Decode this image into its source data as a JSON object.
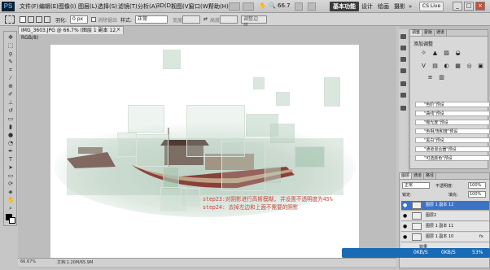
{
  "menubar": {
    "logo": "PS",
    "items": [
      "文件(F)",
      "编辑(E)",
      "图像(I)",
      "图层(L)",
      "选择(S)",
      "滤镜(T)",
      "分析(A)",
      "3D(D)",
      "视图(V)",
      "窗口(W)",
      "帮助(H)"
    ],
    "zoom": "66.7",
    "workspaces": [
      "基本功能",
      "设计",
      "绘画",
      "摄影",
      "»"
    ],
    "cs_live": "CS Live",
    "window_controls": [
      "_",
      "□",
      "×"
    ]
  },
  "options": {
    "feather_label": "羽化:",
    "feather_value": "0 px",
    "antialias": "消除锯齿",
    "style_label": "样式:",
    "style_value": "正常",
    "width_label": "宽度:",
    "height_label": "高度:",
    "refine": "调整边缘..."
  },
  "document": {
    "tab_title": "IMG_3603.JPG @ 66.7% (图层 1 副本 12, RGB/8)",
    "close": "×",
    "status_zoom": "66.67%",
    "status_doc": "文档:1.20M/65.9M",
    "step_lines": [
      "step23:对阴影进行高斯模糊, 并设置不透明度为45%",
      "step24: 去掉左边和上面不需要的阴影"
    ]
  },
  "adjust_panel": {
    "tabs": [
      "调整",
      "蒙版",
      "通道"
    ],
    "title": "添加调整",
    "icons": [
      "☼",
      "▲",
      "▨",
      "◒",
      "V",
      "▤",
      "◐",
      "▦",
      "◎",
      "▣",
      "≡",
      "▥"
    ],
    "presets": [
      "\"色阶\"预设",
      "\"曲线\"预设",
      "\"曝光度\"预设",
      "\"色相/饱和度\"预设",
      "\"黑白\"预设",
      "\"通道混合器\"预设",
      "\"可选颜色\"预设"
    ]
  },
  "layers_panel": {
    "tabs": [
      "图层",
      "通道",
      "路径"
    ],
    "blend_mode": "正常",
    "opacity_label": "不透明度:",
    "opacity_value": "100%",
    "lock_label": "锁定:",
    "fill_label": "填充:",
    "fill_value": "100%",
    "layers": [
      "图层 1 副本 12",
      "图层2",
      "图层 1 副本 11",
      "图层 1 副本 10",
      "效果"
    ]
  },
  "taskbar": {
    "upload": "0KB/S",
    "download": "0KB/S",
    "percent": "53%"
  },
  "colors": {
    "accent": "#3d73c5",
    "step_text": "#c4453d"
  }
}
